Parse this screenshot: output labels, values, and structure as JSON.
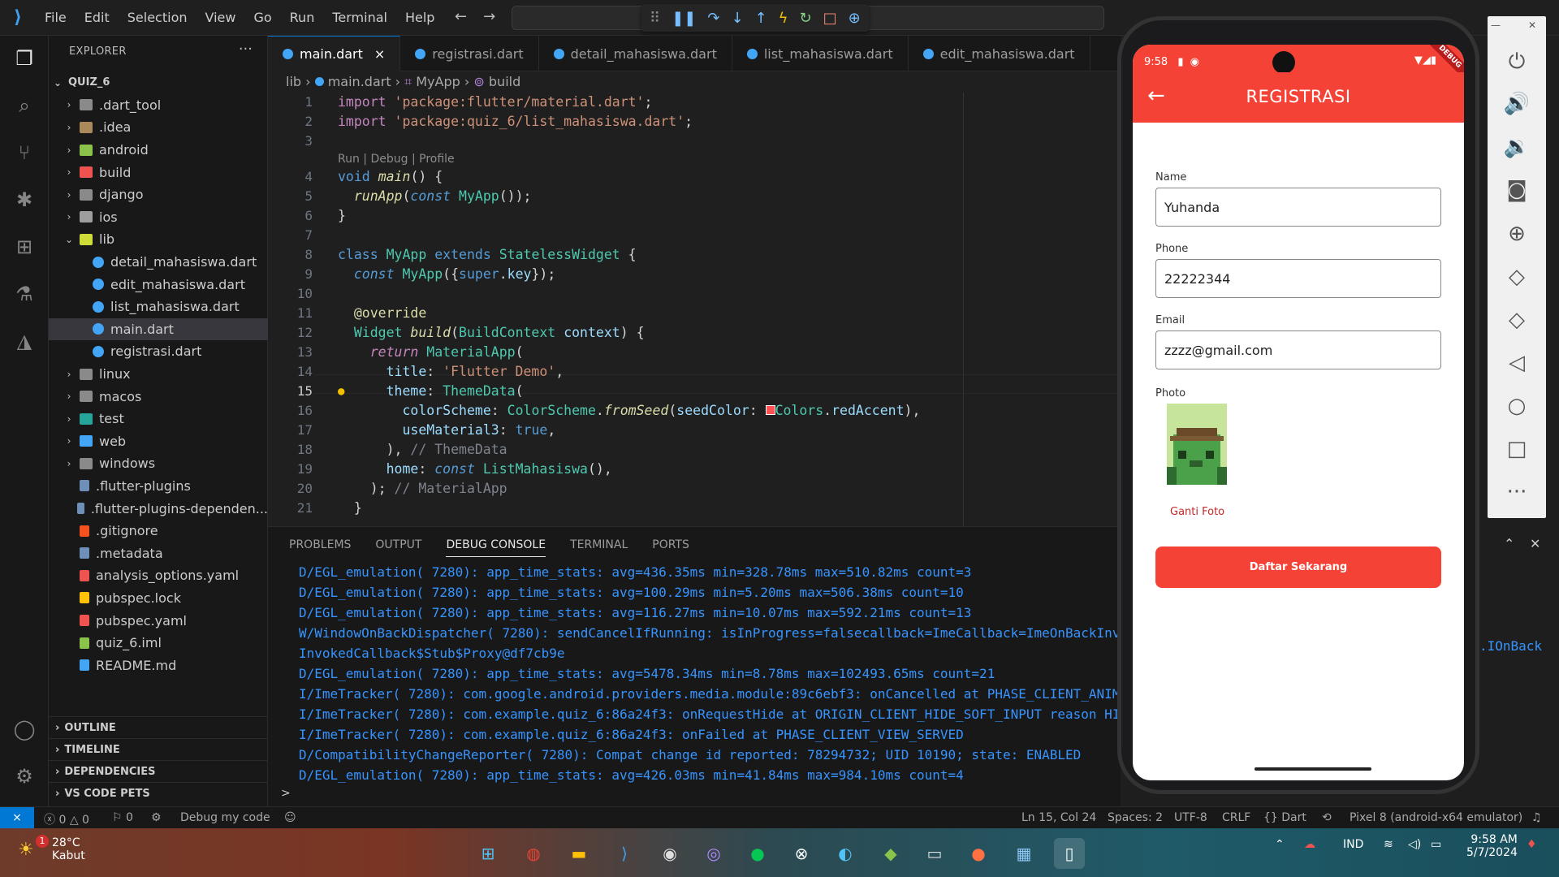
{
  "titlebar": {
    "menu": [
      "File",
      "Edit",
      "Selection",
      "View",
      "Go",
      "Run",
      "Terminal",
      "Help"
    ]
  },
  "explorer": {
    "title": "EXPLORER",
    "more": "···",
    "root": "QUIZ_6",
    "items": [
      {
        "label": ".dart_tool",
        "type": "folder",
        "depth": 1,
        "expanded": false
      },
      {
        "label": ".idea",
        "type": "folder",
        "depth": 1,
        "expanded": false
      },
      {
        "label": "android",
        "type": "folder",
        "depth": 1,
        "expanded": false
      },
      {
        "label": "build",
        "type": "folder",
        "depth": 1,
        "expanded": false
      },
      {
        "label": "django",
        "type": "folder",
        "depth": 1,
        "expanded": false
      },
      {
        "label": "ios",
        "type": "folder",
        "depth": 1,
        "expanded": false
      },
      {
        "label": "lib",
        "type": "folder",
        "depth": 1,
        "expanded": true
      },
      {
        "label": "detail_mahasiswa.dart",
        "type": "dart",
        "depth": 2
      },
      {
        "label": "edit_mahasiswa.dart",
        "type": "dart",
        "depth": 2
      },
      {
        "label": "list_mahasiswa.dart",
        "type": "dart",
        "depth": 2
      },
      {
        "label": "main.dart",
        "type": "dart",
        "depth": 2,
        "selected": true
      },
      {
        "label": "registrasi.dart",
        "type": "dart",
        "depth": 2
      },
      {
        "label": "linux",
        "type": "folder",
        "depth": 1,
        "expanded": false
      },
      {
        "label": "macos",
        "type": "folder",
        "depth": 1,
        "expanded": false
      },
      {
        "label": "test",
        "type": "folder",
        "depth": 1,
        "expanded": false
      },
      {
        "label": "web",
        "type": "folder",
        "depth": 1,
        "expanded": false
      },
      {
        "label": "windows",
        "type": "folder",
        "depth": 1,
        "expanded": false
      },
      {
        "label": ".flutter-plugins",
        "type": "file",
        "depth": 1
      },
      {
        "label": ".flutter-plugins-dependen...",
        "type": "file",
        "depth": 1
      },
      {
        "label": ".gitignore",
        "type": "git",
        "depth": 1
      },
      {
        "label": ".metadata",
        "type": "file",
        "depth": 1
      },
      {
        "label": "analysis_options.yaml",
        "type": "yaml",
        "depth": 1
      },
      {
        "label": "pubspec.lock",
        "type": "lock",
        "depth": 1
      },
      {
        "label": "pubspec.yaml",
        "type": "yaml",
        "depth": 1
      },
      {
        "label": "quiz_6.iml",
        "type": "iml",
        "depth": 1
      },
      {
        "label": "README.md",
        "type": "info",
        "depth": 1
      }
    ],
    "sections": [
      "OUTLINE",
      "TIMELINE",
      "DEPENDENCIES",
      "VS CODE PETS"
    ]
  },
  "tabs": [
    {
      "label": "main.dart",
      "active": true,
      "close": "×"
    },
    {
      "label": "registrasi.dart"
    },
    {
      "label": "detail_mahasiswa.dart"
    },
    {
      "label": "list_mahasiswa.dart"
    },
    {
      "label": "edit_mahasiswa.dart"
    }
  ],
  "breadcrumb": [
    "lib",
    "main.dart",
    "MyApp",
    "build"
  ],
  "editor": {
    "codelens": "Run | Debug | Profile",
    "current_line": "15"
  },
  "panel": {
    "tabs": [
      "PROBLEMS",
      "OUTPUT",
      "DEBUG CONSOLE",
      "TERMINAL",
      "PORTS"
    ],
    "active_tab": "DEBUG CONSOLE",
    "log": [
      "D/EGL_emulation( 7280): app_time_stats: avg=436.35ms min=328.78ms max=510.82ms count=3",
      "D/EGL_emulation( 7280): app_time_stats: avg=100.29ms min=5.20ms max=506.38ms count=10",
      "D/EGL_emulation( 7280): app_time_stats: avg=116.27ms min=10.07ms max=592.21ms count=13",
      "W/WindowOnBackDispatcher( 7280): sendCancelIfRunning: isInProgress=falsecallback=ImeCallback=ImeOnBackInv",
      "InvokedCallback$Stub$Proxy@df7cb9e",
      "D/EGL_emulation( 7280): app_time_stats: avg=5478.34ms min=8.78ms max=102493.65ms count=21",
      "I/ImeTracker( 7280): com.google.android.providers.media.module:89c6ebf3: onCancelled at PHASE_CLIENT_ANIM",
      "I/ImeTracker( 7280): com.example.quiz_6:86a24f3: onRequestHide at ORIGIN_CLIENT_HIDE_SOFT_INPUT reason HI",
      "I/ImeTracker( 7280): com.example.quiz_6:86a24f3: onFailed at PHASE_CLIENT_VIEW_SERVED",
      "D/CompatibilityChangeReporter( 7280): Compat change id reported: 78294732; UID 10190; state: ENABLED",
      "D/EGL_emulation( 7280): app_time_stats: avg=426.03ms min=41.84ms max=984.10ms count=4"
    ],
    "log_overflow": ".IOnBack",
    "prompt": ">"
  },
  "statusbar": {
    "errors": "0",
    "warnings": "0",
    "ports": "0",
    "debug": "Debug my code",
    "position": "Ln 15, Col 24",
    "spaces": "Spaces: 2",
    "encoding": "UTF-8",
    "eol": "CRLF",
    "language": "Dart",
    "device": "Pixel 8 (android-x64 emulator)"
  },
  "phone": {
    "time": "9:58",
    "debug_banner": "DEBUG",
    "appbar_title": "REGISTRASI",
    "name_label": "Name",
    "name_value": "Yuhanda",
    "phone_label": "Phone",
    "phone_value": "22222344",
    "email_label": "Email",
    "email_value": "zzzz@gmail.com",
    "photo_label": "Photo",
    "change_photo": "Ganti Foto",
    "submit": "Daftar Sekarang",
    "accent": "#f44336"
  },
  "emulator_tools": [
    "power-icon",
    "volume-up-icon",
    "volume-down-icon",
    "camera-icon",
    "zoom-icon",
    "rotate-left-icon",
    "rotate-right-icon",
    "back-icon",
    "home-icon",
    "overview-icon",
    "more-icon"
  ],
  "taskbar": {
    "temp": "28°C",
    "weather": "Kabut",
    "weather_badge": "1",
    "lang": "IND",
    "time": "9:58 AM",
    "date": "5/7/2024"
  }
}
